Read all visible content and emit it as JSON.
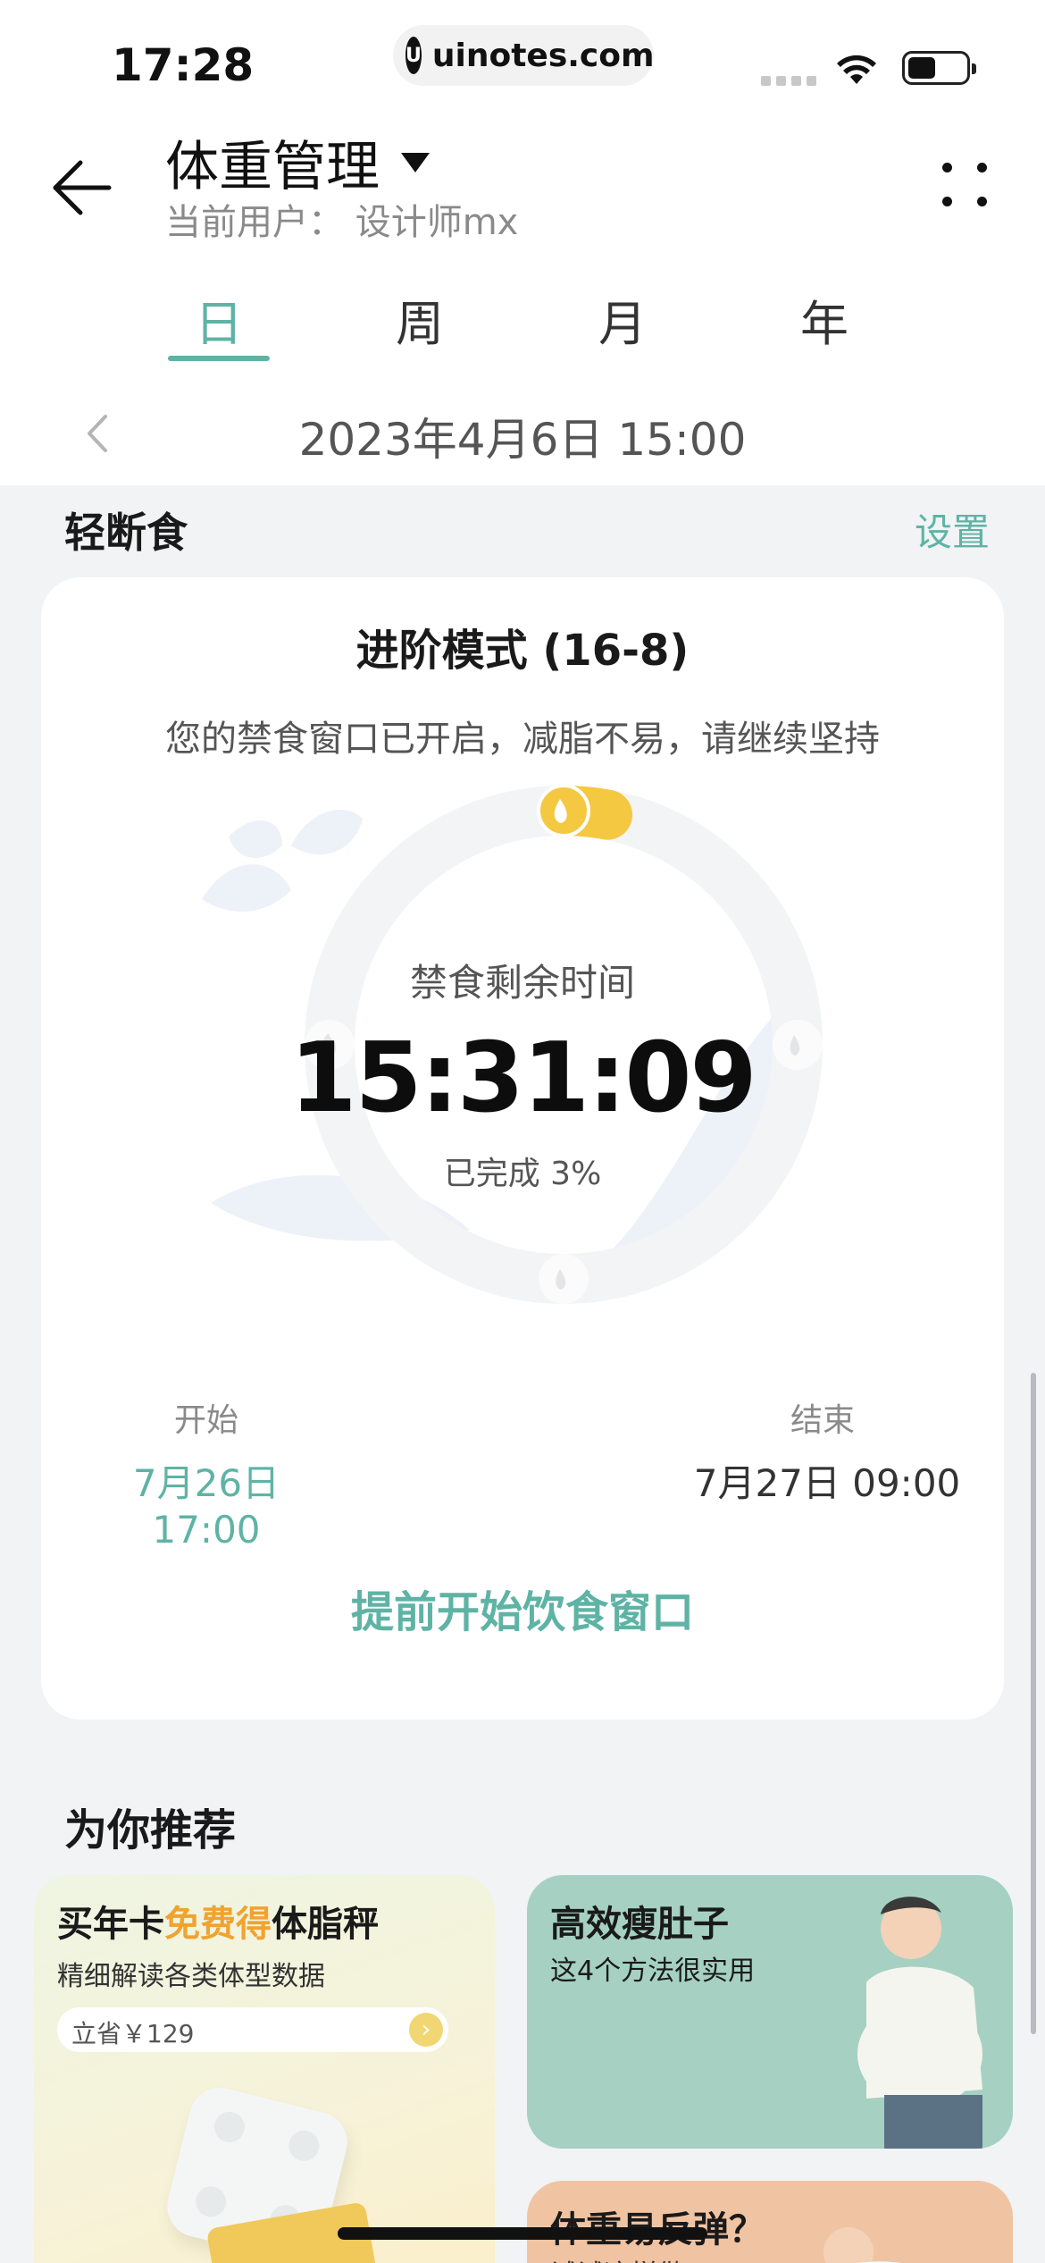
{
  "status_bar": {
    "time": "17:28",
    "url": "uinotes.com",
    "url_logo": "U"
  },
  "header": {
    "title": "体重管理",
    "subtitle": "当前用户： 设计师mx",
    "back_icon": "arrow-left-icon",
    "more_icon": "more-vertical-icon"
  },
  "tabs": [
    {
      "label": "日",
      "active": true
    },
    {
      "label": "周",
      "active": false
    },
    {
      "label": "月",
      "active": false
    },
    {
      "label": "年",
      "active": false
    }
  ],
  "date_nav": {
    "date": "2023年4月6日 15:00"
  },
  "fasting": {
    "section_title": "轻断食",
    "settings_label": "设置",
    "mode": "进阶模式 (16-8)",
    "message": "您的禁食窗口已开启，减脂不易，请继续坚持",
    "remaining_label": "禁食剩余时间",
    "remaining_time": "15:31:09",
    "progress_text": "已完成 3%",
    "progress_value": 0.03,
    "start_label": "开始",
    "start_value": "7月26日 17:00",
    "end_label": "结束",
    "end_value": "7月27日 09:00",
    "early_button": "提前开始饮食窗口"
  },
  "recommend": {
    "title": "为你推荐",
    "promo1": {
      "title_a": "买年卡",
      "title_highlight": "免费得",
      "title_b": "体脂秤",
      "subtitle": "精细解读各类体型数据",
      "pill_text": "立省￥129"
    },
    "promo2": {
      "title": "高效瘦肚子",
      "subtitle": "这4个方法很实用"
    },
    "promo3": {
      "title": "体重易反弹？",
      "subtitle": "试试这样做"
    }
  },
  "colors": {
    "accent": "#5fb3a5",
    "highlight": "#f0a330",
    "ring_track": "#f3f4f5",
    "progress_dot": "#f5c842"
  }
}
